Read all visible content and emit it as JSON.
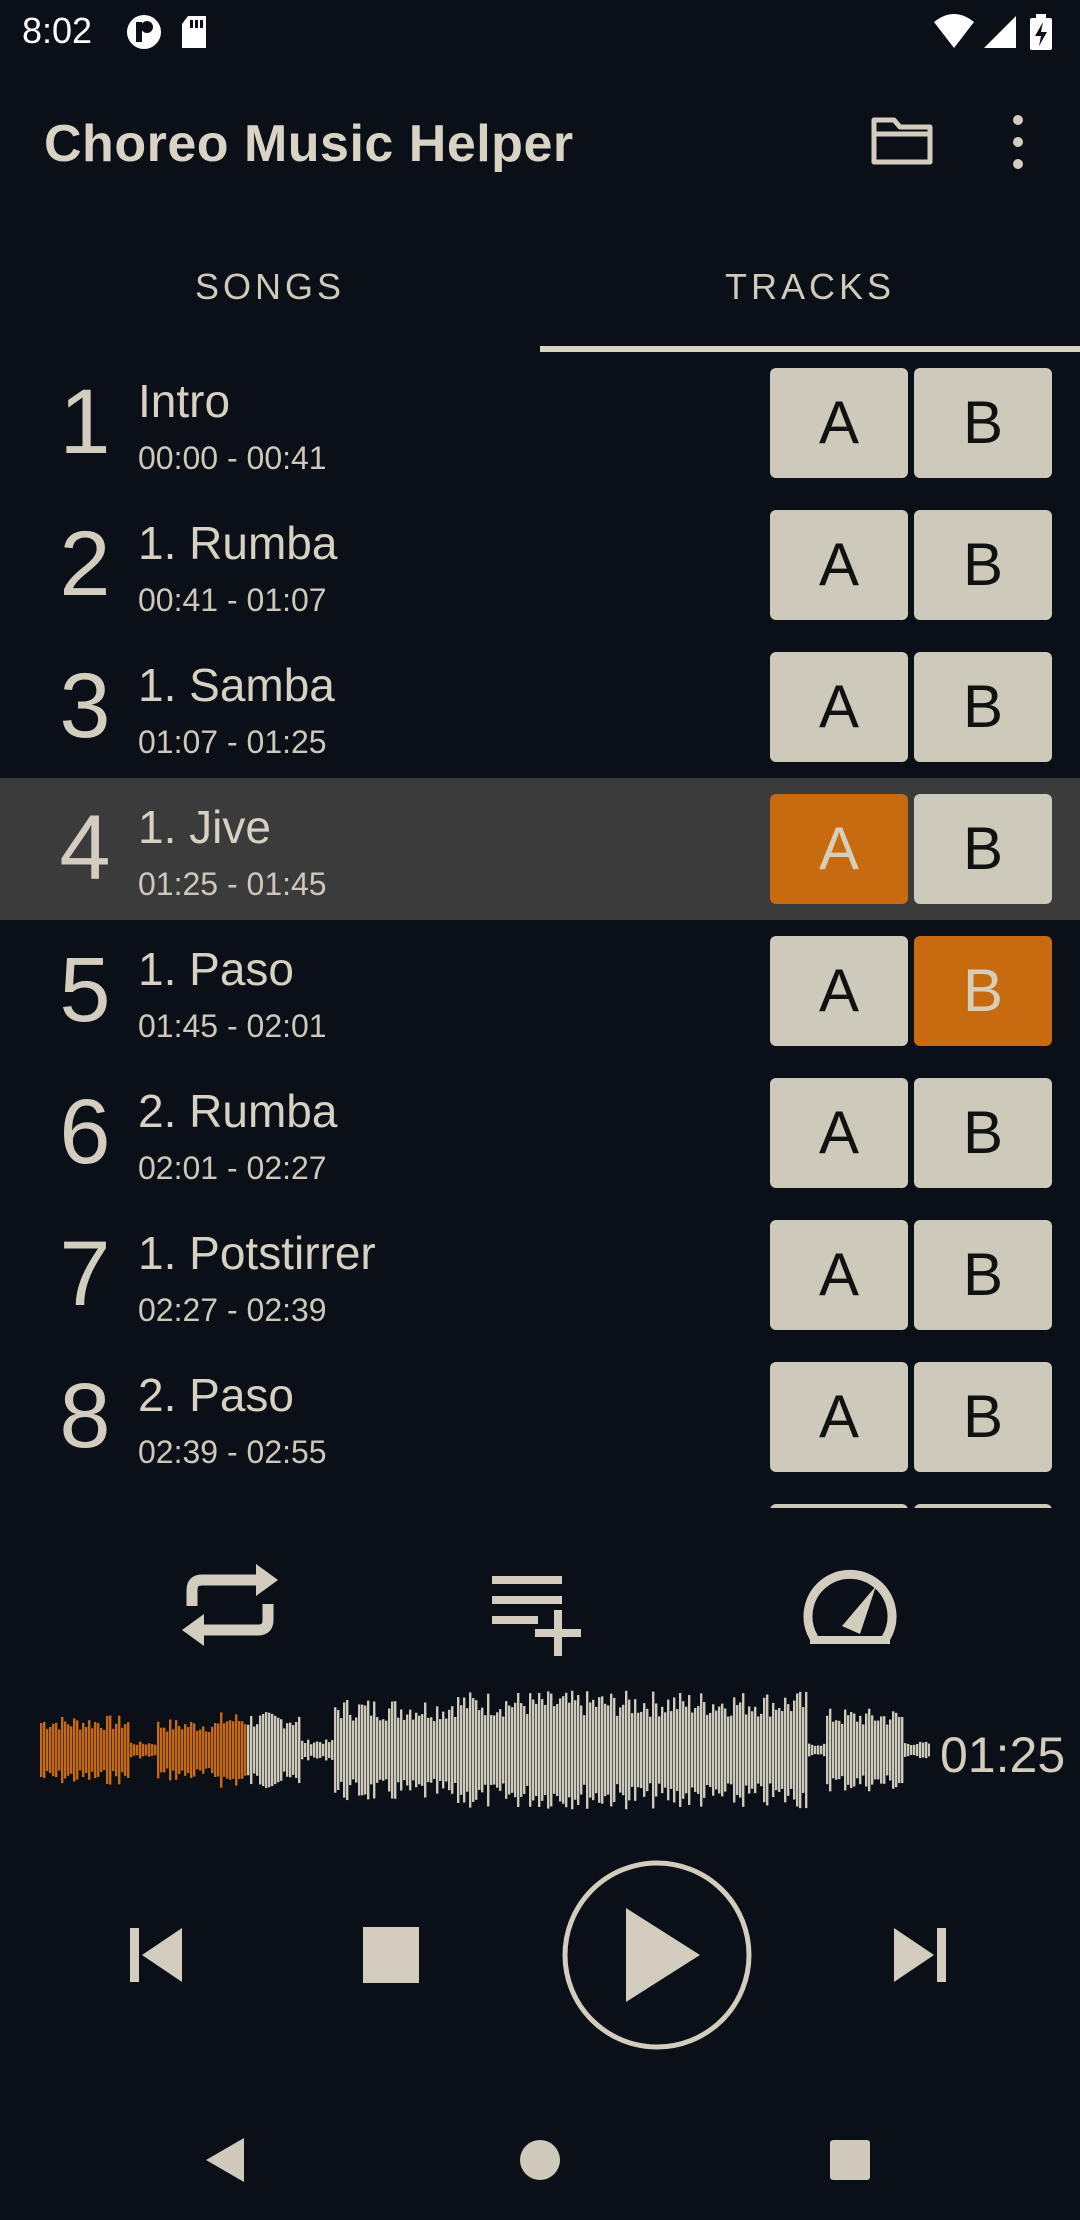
{
  "status_bar": {
    "time": "8:02",
    "left_icons": [
      "app-notification-icon",
      "sd-card-icon"
    ],
    "right_icons": [
      "wifi-icon",
      "signal-icon",
      "battery-charging-icon"
    ]
  },
  "app_bar": {
    "title": "Choreo Music Helper",
    "icons": [
      "folder-icon",
      "more-vert-icon"
    ]
  },
  "tabs": [
    {
      "label": "SONGS",
      "selected": false
    },
    {
      "label": "TRACKS",
      "selected": true
    }
  ],
  "tracks": [
    {
      "num": "1",
      "name": "Intro",
      "range": "00:00 - 00:41",
      "selected": false,
      "a": "A",
      "b": "B",
      "a_active": false,
      "b_active": false
    },
    {
      "num": "2",
      "name": "1. Rumba",
      "range": "00:41 - 01:07",
      "selected": false,
      "a": "A",
      "b": "B",
      "a_active": false,
      "b_active": false
    },
    {
      "num": "3",
      "name": "1. Samba",
      "range": "01:07 - 01:25",
      "selected": false,
      "a": "A",
      "b": "B",
      "a_active": false,
      "b_active": false
    },
    {
      "num": "4",
      "name": "1. Jive",
      "range": "01:25 - 01:45",
      "selected": true,
      "a": "A",
      "b": "B",
      "a_active": true,
      "b_active": false
    },
    {
      "num": "5",
      "name": "1. Paso",
      "range": "01:45 - 02:01",
      "selected": false,
      "a": "A",
      "b": "B",
      "a_active": false,
      "b_active": true
    },
    {
      "num": "6",
      "name": "2. Rumba",
      "range": "02:01 - 02:27",
      "selected": false,
      "a": "A",
      "b": "B",
      "a_active": false,
      "b_active": false
    },
    {
      "num": "7",
      "name": "1. Potstirrer",
      "range": "02:27 - 02:39",
      "selected": false,
      "a": "A",
      "b": "B",
      "a_active": false,
      "b_active": false
    },
    {
      "num": "8",
      "name": "2. Paso",
      "range": "02:39 - 02:55",
      "selected": false,
      "a": "A",
      "b": "B",
      "a_active": false,
      "b_active": false
    }
  ],
  "mode_controls": [
    "repeat-icon",
    "playlist-add-icon",
    "speed-icon"
  ],
  "player": {
    "position": "01:25",
    "played_fraction": 0.23
  },
  "transport": [
    "skip-previous-icon",
    "stop-icon",
    "play-icon",
    "skip-next-icon"
  ],
  "nav_bar": [
    "back-icon",
    "home-icon",
    "recents-icon"
  ],
  "colors": {
    "background": "#0b0f17",
    "accent": "#c76a10",
    "button": "#cdcabb",
    "selected_row": "#3b3b3b",
    "text": "#d2cdbe"
  }
}
